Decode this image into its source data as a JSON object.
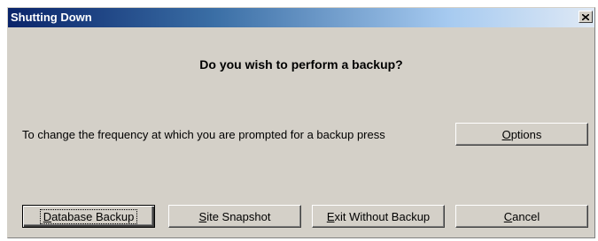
{
  "window": {
    "title": "Shutting Down",
    "close_glyph": "close-icon"
  },
  "question": "Do you wish to perform a backup?",
  "frequency_text": "To change the frequency at which you are prompted for a backup press",
  "buttons": {
    "options": {
      "mnemonic": "O",
      "rest": "ptions"
    },
    "database_backup": {
      "mnemonic": "D",
      "rest": "atabase Backup"
    },
    "site_snapshot": {
      "mnemonic": "S",
      "rest": "ite Snapshot"
    },
    "exit_without_backup": {
      "mnemonic": "E",
      "rest": "xit Without Backup"
    },
    "cancel": {
      "mnemonic": "C",
      "rest": "ancel"
    }
  },
  "colors": {
    "dialog_face": "#d4d0c8",
    "title_start": "#0a246a",
    "title_end": "#dfe9f5"
  }
}
